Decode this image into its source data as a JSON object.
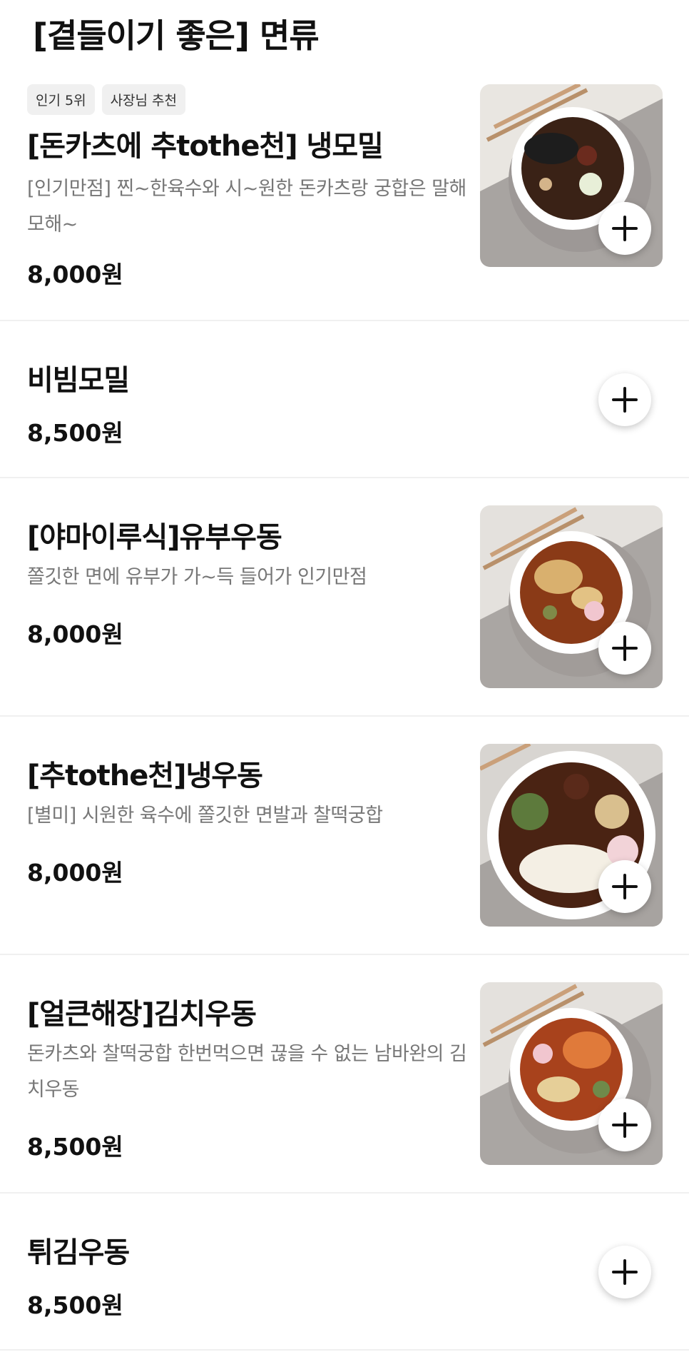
{
  "section": {
    "title": "[곁들이기 좋은] 면류"
  },
  "items": [
    {
      "badges": [
        "인기 5위",
        "사장님 추천"
      ],
      "name": "[돈카츠에 추tothe천] 냉모밀",
      "desc": "[인기만점] 찐~한육수와 시~원한 돈카츠랑 궁합은 말해모해~",
      "price": "8,000원",
      "image": "cold-soba-photo"
    },
    {
      "name": "비빔모밀",
      "price": "8,500원"
    },
    {
      "name": "[야마이루식]유부우동",
      "desc": "쫄깃한 면에 유부가 가~득 들어가 인기만점",
      "price": "8,000원",
      "image": "fried-tofu-udon-photo"
    },
    {
      "name": "[추tothe천]냉우동",
      "desc": "[별미] 시원한 육수에 쫄깃한 면발과 찰떡궁합",
      "price": "8,000원",
      "image": "cold-udon-photo"
    },
    {
      "name": "[얼큰해장]김치우동",
      "desc": "돈카츠와 찰떡궁합 한번먹으면 끊을 수 없는 남바완의 김치우동",
      "price": "8,500원",
      "image": "kimchi-udon-photo"
    },
    {
      "name": "튀김우동",
      "price": "8,500원"
    }
  ],
  "icons": {
    "add": "plus-icon"
  },
  "colors": {
    "divider": "#f0f0f0",
    "badge_bg": "#f0f0f0",
    "desc_text": "#777777"
  }
}
